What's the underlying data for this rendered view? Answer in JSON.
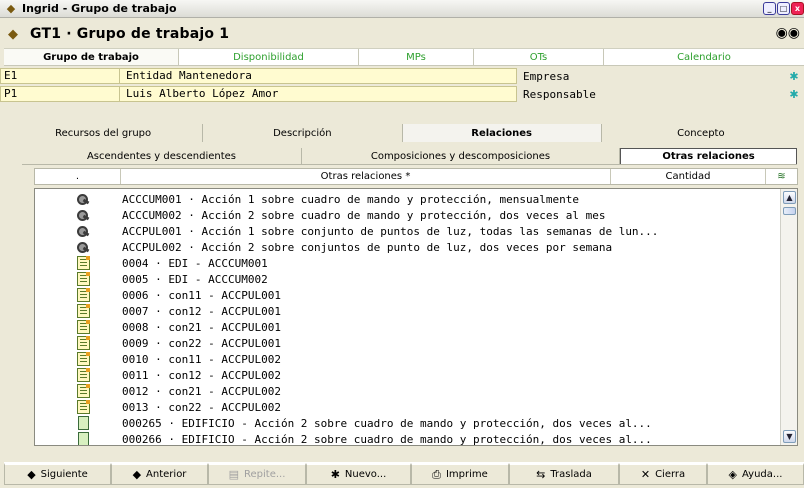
{
  "window": {
    "title": "Ingrid - Grupo de trabajo",
    "buttons": [
      "_",
      "□",
      "x"
    ]
  },
  "header": {
    "title": "GT1 · Grupo de trabajo 1"
  },
  "top_tabs": [
    {
      "label": "Grupo de trabajo",
      "active": true
    },
    {
      "label": "Disponibilidad"
    },
    {
      "label": "MPs"
    },
    {
      "label": "OTs"
    },
    {
      "label": "Calendario"
    }
  ],
  "fields": [
    {
      "code": "E1",
      "value": "Entidad Mantenedora",
      "label": "Empresa"
    },
    {
      "code": "P1",
      "value": "Luis Alberto López Amor",
      "label": "Responsable"
    }
  ],
  "tabs_level2": [
    {
      "label": "Recursos del grupo"
    },
    {
      "label": "Descripción"
    },
    {
      "label": "Relaciones",
      "active": true
    },
    {
      "label": "Concepto"
    }
  ],
  "tabs_level3": [
    {
      "label": "Ascendentes y descendientes"
    },
    {
      "label": "Composiciones y descomposiciones"
    },
    {
      "label": "Otras relaciones",
      "active": true
    }
  ],
  "grid": {
    "columns": [
      ".",
      "Otras relaciones *",
      "Cantidad",
      "≋"
    ],
    "rows": [
      {
        "icon": "key-icon",
        "text": "ACCCUM001 · Acción 1 sobre cuadro de mando y protección, mensualmente"
      },
      {
        "icon": "key-icon",
        "text": "ACCCUM002 · Acción 2 sobre cuadro de mando y protección, dos veces al mes"
      },
      {
        "icon": "key-icon",
        "text": "ACCPUL001 · Acción 1 sobre conjunto de puntos de luz, todas las semanas de lun..."
      },
      {
        "icon": "key-icon",
        "text": "ACCPUL002 · Acción 2 sobre conjuntos de punto de luz, dos veces por semana"
      },
      {
        "icon": "document-icon",
        "text": "0004 · EDI - ACCCUM001"
      },
      {
        "icon": "document-icon",
        "text": "0005 · EDI - ACCCUM002"
      },
      {
        "icon": "document-icon",
        "text": "0006 · con11 - ACCPUL001"
      },
      {
        "icon": "document-icon",
        "text": "0007 · con12 - ACCPUL001"
      },
      {
        "icon": "document-icon",
        "text": "0008 · con21 - ACCPUL001"
      },
      {
        "icon": "document-icon",
        "text": "0009 · con22 - ACCPUL001"
      },
      {
        "icon": "document-icon",
        "text": "0010 · con11 - ACCPUL002"
      },
      {
        "icon": "document-icon",
        "text": "0011 · con12 - ACCPUL002"
      },
      {
        "icon": "document-icon",
        "text": "0012 · con21 - ACCPUL002"
      },
      {
        "icon": "document-icon",
        "text": "0013 · con22 - ACCPUL002"
      },
      {
        "icon": "notepad-icon",
        "text": "000265 · EDIFICIO - Acción 2 sobre cuadro de mando y protección, dos veces al..."
      },
      {
        "icon": "notepad-icon",
        "text": "000266 · EDIFICIO - Acción 2 sobre cuadro de mando y protección, dos veces al..."
      }
    ]
  },
  "bottom_buttons": [
    {
      "label": "Siguiente",
      "icon": "◆",
      "name": "next-button"
    },
    {
      "label": "Anterior",
      "icon": "◆",
      "name": "previous-button"
    },
    {
      "label": "Repite...",
      "icon": "▤",
      "name": "repeat-button",
      "disabled": true
    },
    {
      "label": "Nuevo...",
      "icon": "✱",
      "name": "new-button"
    },
    {
      "label": "Imprime",
      "icon": "⎙",
      "name": "print-button"
    },
    {
      "label": "Traslada",
      "icon": "⇆",
      "name": "move-button"
    },
    {
      "label": "Cierra",
      "icon": "✕",
      "name": "close-button"
    },
    {
      "label": "Ayuda...",
      "icon": "◈",
      "name": "help-button"
    }
  ],
  "colors": {
    "field_bg": "#fffbd0",
    "tab_inactive_text": "#2ea02e",
    "window_bg": "#ece9d8"
  }
}
